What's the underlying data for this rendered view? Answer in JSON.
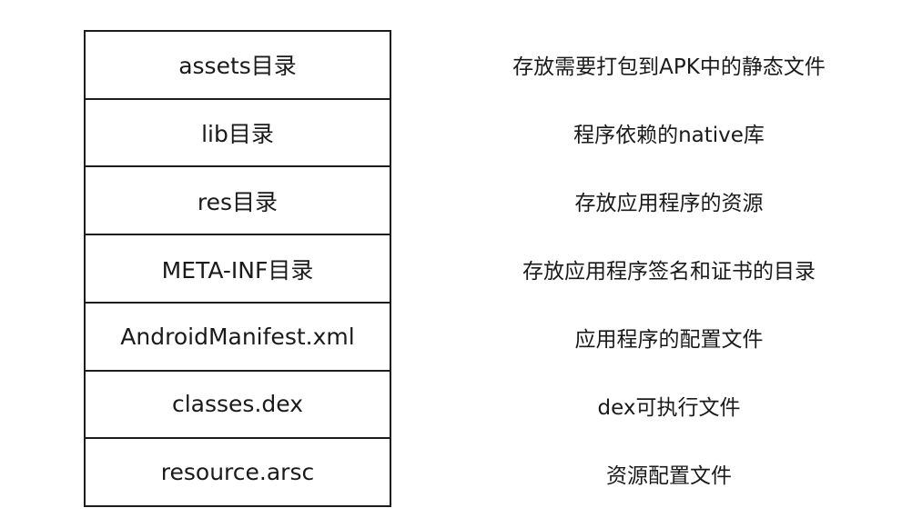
{
  "rows": [
    {
      "name": "assets目录",
      "desc": "存放需要打包到APK中的静态文件"
    },
    {
      "name": "lib目录",
      "desc": "程序依赖的native库"
    },
    {
      "name": "res目录",
      "desc": "存放应用程序的资源"
    },
    {
      "name": "META-INF目录",
      "desc": "存放应用程序签名和证书的目录"
    },
    {
      "name": "AndroidManifest.xml",
      "desc": "应用程序的配置文件"
    },
    {
      "name": "classes.dex",
      "desc": "dex可执行文件"
    },
    {
      "name": "resource.arsc",
      "desc": "资源配置文件"
    }
  ]
}
